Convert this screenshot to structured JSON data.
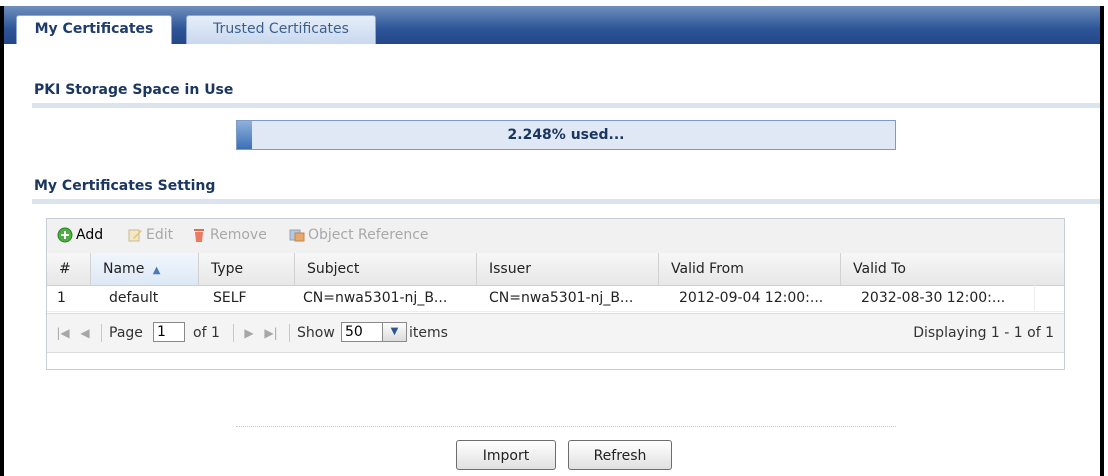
{
  "tabs": [
    {
      "label": "My Certificates",
      "active": true
    },
    {
      "label": "Trusted Certificates",
      "active": false
    }
  ],
  "storage": {
    "title": "PKI Storage Space in Use",
    "used_percent": 2.248,
    "used_label": "2.248% used..."
  },
  "settings": {
    "title": "My Certificates Setting",
    "toolbar": {
      "add": "Add",
      "edit": "Edit",
      "remove": "Remove",
      "object_reference": "Object Reference"
    },
    "columns": [
      "#",
      "Name",
      "Type",
      "Subject",
      "Issuer",
      "Valid From",
      "Valid To"
    ],
    "sort_column": "Name",
    "rows": [
      {
        "index": "1",
        "name": "default",
        "type": "SELF",
        "subject": "CN=nwa5301-nj_B...",
        "issuer": "CN=nwa5301-nj_B...",
        "valid_from": "2012-09-04 12:00:...",
        "valid_to": "2032-08-30 12:00:..."
      }
    ],
    "pager": {
      "page_label": "Page",
      "page_value": "1",
      "of_label": "of 1",
      "show_label": "Show",
      "show_value": "50",
      "items_label": "items",
      "display": "Displaying 1 - 1 of 1"
    }
  },
  "buttons": {
    "import": "Import",
    "refresh": "Refresh"
  },
  "colors": {
    "tabbar": "#2d5596",
    "section_title": "#1b3660",
    "progress_fill": "#3d6fb6"
  }
}
